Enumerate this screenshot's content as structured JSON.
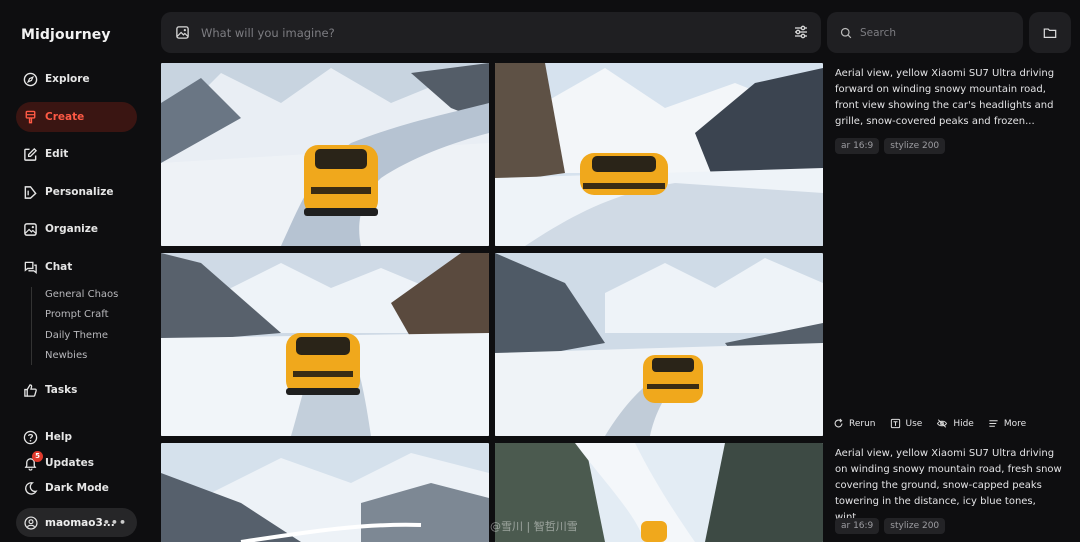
{
  "app": {
    "brand": "Midjourney"
  },
  "sidebar": {
    "items": [
      {
        "label": "Explore",
        "icon": "compass-icon"
      },
      {
        "label": "Create",
        "icon": "brush-icon",
        "active": true
      },
      {
        "label": "Edit",
        "icon": "edit-icon"
      },
      {
        "label": "Personalize",
        "icon": "personalize-icon"
      },
      {
        "label": "Organize",
        "icon": "image-icon"
      },
      {
        "label": "Chat",
        "icon": "chat-icon"
      }
    ],
    "chat_rooms": [
      "General Chaos",
      "Prompt Craft",
      "Daily Theme",
      "Newbies"
    ],
    "tasks": "Tasks",
    "help": "Help",
    "updates": "Updates",
    "updates_badge": "5",
    "dark_mode": "Dark Mode",
    "user": "maomao3...",
    "user_menu": "•••"
  },
  "prompt": {
    "placeholder": "What will you imagine?"
  },
  "search": {
    "placeholder": "Search"
  },
  "jobs": [
    {
      "description": "Aerial view, yellow Xiaomi SU7 Ultra driving forward on winding snowy mountain road, front view showing the car's headlights and grille, snow-covered peaks and frozen...",
      "tags": [
        "ar 16:9",
        "stylize 200"
      ]
    },
    {
      "description": "Aerial view, yellow Xiaomi SU7 Ultra driving on winding snowy mountain road, fresh snow covering the ground, snow-capped peaks towering in the distance, icy blue tones, wint...",
      "tags": [
        "ar 16:9",
        "stylize 200"
      ]
    }
  ],
  "actions": [
    "Rerun",
    "Use",
    "Hide",
    "More"
  ],
  "watermark": "@雪川 | 智哲川雪",
  "colors": {
    "accent": "#ff5a45",
    "car": "#f0a81c",
    "background": "#0e0e10"
  }
}
